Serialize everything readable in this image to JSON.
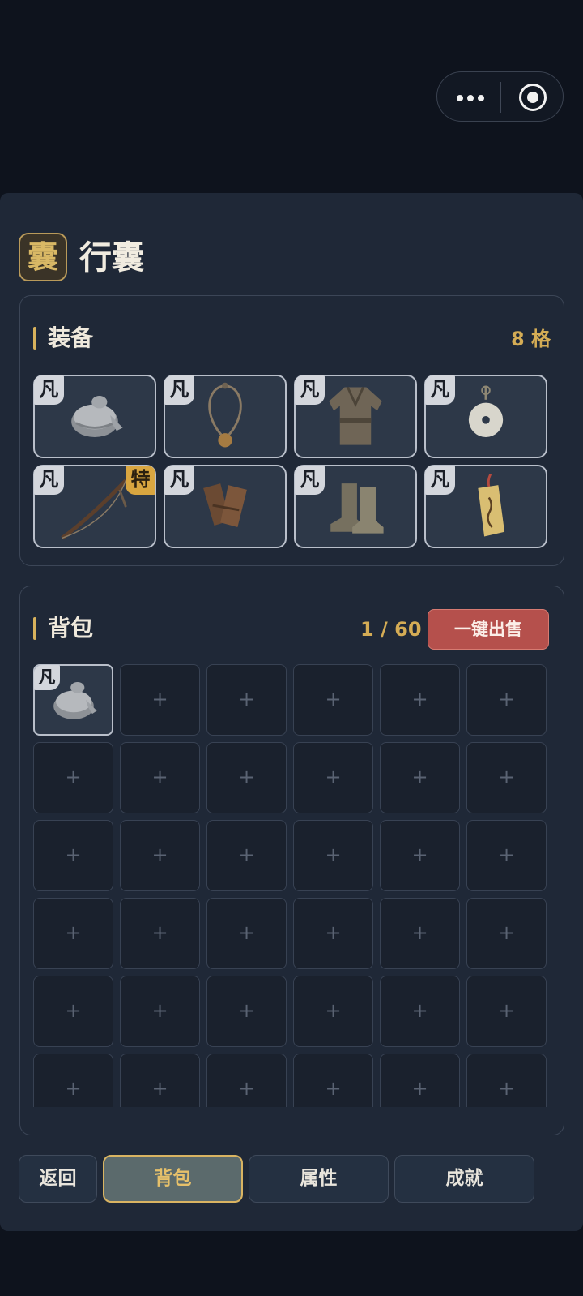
{
  "app_bar": {
    "more_icon": "more-dots-icon",
    "close_icon": "target-circle-icon"
  },
  "header": {
    "badge": "囊",
    "title": "行囊"
  },
  "equipment": {
    "title": "装备",
    "count": "8 格",
    "slots": [
      {
        "item": "cloth-hat",
        "rarity": "凡"
      },
      {
        "item": "pendant-necklace",
        "rarity": "凡"
      },
      {
        "item": "cloth-robe",
        "rarity": "凡"
      },
      {
        "item": "jade-ring-pendant",
        "rarity": "凡"
      },
      {
        "item": "wooden-bow",
        "rarity": "凡",
        "special": "特"
      },
      {
        "item": "leather-bracers",
        "rarity": "凡"
      },
      {
        "item": "cloth-boots",
        "rarity": "凡"
      },
      {
        "item": "talisman-tag",
        "rarity": "凡"
      }
    ]
  },
  "backpack": {
    "title": "背包",
    "count": "1 / 60",
    "sell_all": "一键出售",
    "empty_symbol": "+",
    "items": [
      {
        "item": "cloth-hat",
        "rarity": "凡"
      }
    ]
  },
  "bottom_nav": [
    {
      "label": "返回",
      "active": false
    },
    {
      "label": "背包",
      "active": true
    },
    {
      "label": "属性",
      "active": false
    },
    {
      "label": "成就",
      "active": false
    }
  ],
  "colors": {
    "accent_gold": "#d4ac55",
    "sell_red": "#b5504c",
    "panel": "#1f2837",
    "background": "#0e131d"
  }
}
